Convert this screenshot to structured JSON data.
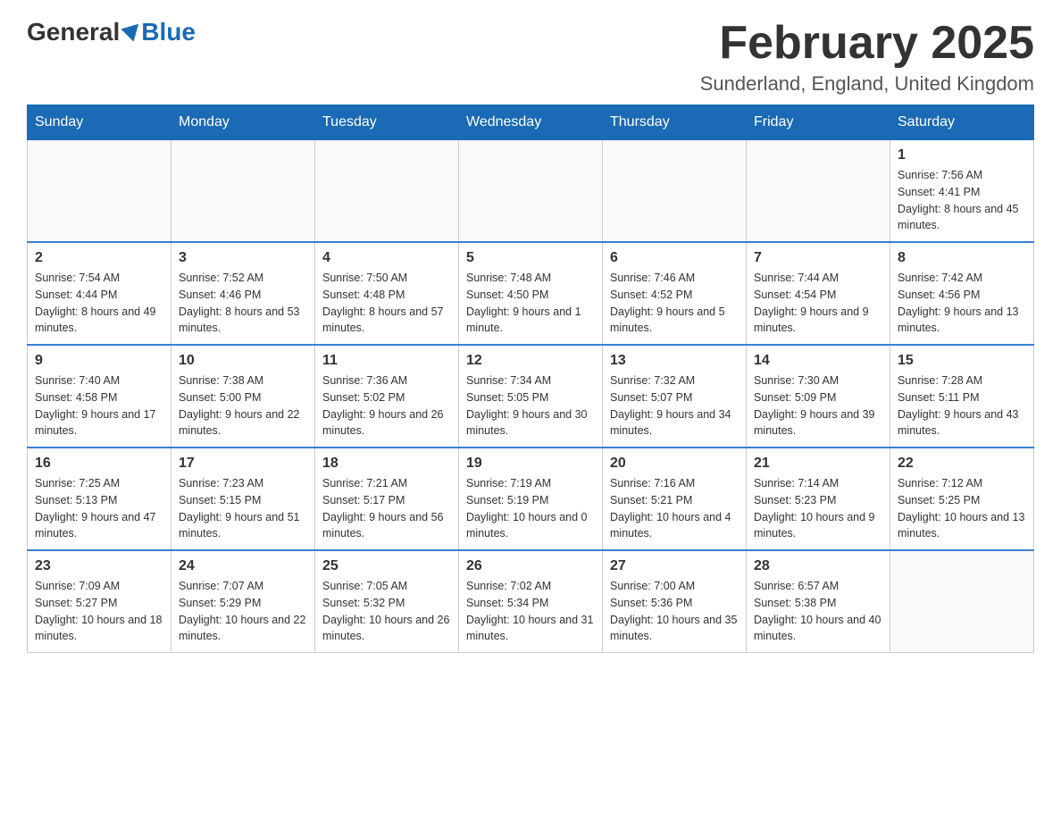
{
  "header": {
    "logo": {
      "text_general": "General",
      "text_blue": "Blue"
    },
    "title": "February 2025",
    "subtitle": "Sunderland, England, United Kingdom"
  },
  "weekdays": [
    "Sunday",
    "Monday",
    "Tuesday",
    "Wednesday",
    "Thursday",
    "Friday",
    "Saturday"
  ],
  "weeks": [
    [
      {
        "day": "",
        "info": ""
      },
      {
        "day": "",
        "info": ""
      },
      {
        "day": "",
        "info": ""
      },
      {
        "day": "",
        "info": ""
      },
      {
        "day": "",
        "info": ""
      },
      {
        "day": "",
        "info": ""
      },
      {
        "day": "1",
        "info": "Sunrise: 7:56 AM\nSunset: 4:41 PM\nDaylight: 8 hours and 45 minutes."
      }
    ],
    [
      {
        "day": "2",
        "info": "Sunrise: 7:54 AM\nSunset: 4:44 PM\nDaylight: 8 hours and 49 minutes."
      },
      {
        "day": "3",
        "info": "Sunrise: 7:52 AM\nSunset: 4:46 PM\nDaylight: 8 hours and 53 minutes."
      },
      {
        "day": "4",
        "info": "Sunrise: 7:50 AM\nSunset: 4:48 PM\nDaylight: 8 hours and 57 minutes."
      },
      {
        "day": "5",
        "info": "Sunrise: 7:48 AM\nSunset: 4:50 PM\nDaylight: 9 hours and 1 minute."
      },
      {
        "day": "6",
        "info": "Sunrise: 7:46 AM\nSunset: 4:52 PM\nDaylight: 9 hours and 5 minutes."
      },
      {
        "day": "7",
        "info": "Sunrise: 7:44 AM\nSunset: 4:54 PM\nDaylight: 9 hours and 9 minutes."
      },
      {
        "day": "8",
        "info": "Sunrise: 7:42 AM\nSunset: 4:56 PM\nDaylight: 9 hours and 13 minutes."
      }
    ],
    [
      {
        "day": "9",
        "info": "Sunrise: 7:40 AM\nSunset: 4:58 PM\nDaylight: 9 hours and 17 minutes."
      },
      {
        "day": "10",
        "info": "Sunrise: 7:38 AM\nSunset: 5:00 PM\nDaylight: 9 hours and 22 minutes."
      },
      {
        "day": "11",
        "info": "Sunrise: 7:36 AM\nSunset: 5:02 PM\nDaylight: 9 hours and 26 minutes."
      },
      {
        "day": "12",
        "info": "Sunrise: 7:34 AM\nSunset: 5:05 PM\nDaylight: 9 hours and 30 minutes."
      },
      {
        "day": "13",
        "info": "Sunrise: 7:32 AM\nSunset: 5:07 PM\nDaylight: 9 hours and 34 minutes."
      },
      {
        "day": "14",
        "info": "Sunrise: 7:30 AM\nSunset: 5:09 PM\nDaylight: 9 hours and 39 minutes."
      },
      {
        "day": "15",
        "info": "Sunrise: 7:28 AM\nSunset: 5:11 PM\nDaylight: 9 hours and 43 minutes."
      }
    ],
    [
      {
        "day": "16",
        "info": "Sunrise: 7:25 AM\nSunset: 5:13 PM\nDaylight: 9 hours and 47 minutes."
      },
      {
        "day": "17",
        "info": "Sunrise: 7:23 AM\nSunset: 5:15 PM\nDaylight: 9 hours and 51 minutes."
      },
      {
        "day": "18",
        "info": "Sunrise: 7:21 AM\nSunset: 5:17 PM\nDaylight: 9 hours and 56 minutes."
      },
      {
        "day": "19",
        "info": "Sunrise: 7:19 AM\nSunset: 5:19 PM\nDaylight: 10 hours and 0 minutes."
      },
      {
        "day": "20",
        "info": "Sunrise: 7:16 AM\nSunset: 5:21 PM\nDaylight: 10 hours and 4 minutes."
      },
      {
        "day": "21",
        "info": "Sunrise: 7:14 AM\nSunset: 5:23 PM\nDaylight: 10 hours and 9 minutes."
      },
      {
        "day": "22",
        "info": "Sunrise: 7:12 AM\nSunset: 5:25 PM\nDaylight: 10 hours and 13 minutes."
      }
    ],
    [
      {
        "day": "23",
        "info": "Sunrise: 7:09 AM\nSunset: 5:27 PM\nDaylight: 10 hours and 18 minutes."
      },
      {
        "day": "24",
        "info": "Sunrise: 7:07 AM\nSunset: 5:29 PM\nDaylight: 10 hours and 22 minutes."
      },
      {
        "day": "25",
        "info": "Sunrise: 7:05 AM\nSunset: 5:32 PM\nDaylight: 10 hours and 26 minutes."
      },
      {
        "day": "26",
        "info": "Sunrise: 7:02 AM\nSunset: 5:34 PM\nDaylight: 10 hours and 31 minutes."
      },
      {
        "day": "27",
        "info": "Sunrise: 7:00 AM\nSunset: 5:36 PM\nDaylight: 10 hours and 35 minutes."
      },
      {
        "day": "28",
        "info": "Sunrise: 6:57 AM\nSunset: 5:38 PM\nDaylight: 10 hours and 40 minutes."
      },
      {
        "day": "",
        "info": ""
      }
    ]
  ]
}
